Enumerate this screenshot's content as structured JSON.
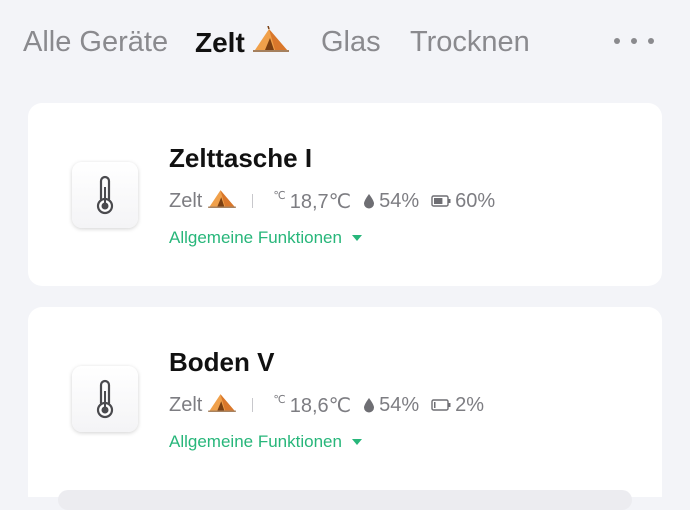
{
  "tabs": [
    {
      "label": "Alle Geräte",
      "active": false
    },
    {
      "label": "Zelt",
      "active": true,
      "icon": "tent-icon"
    },
    {
      "label": "Glas",
      "active": false
    },
    {
      "label": "Trocknen",
      "active": false
    }
  ],
  "more_icon": "more-horizontal-icon",
  "accent_color": "#27b67a",
  "devices": [
    {
      "name": "Zelttasche I",
      "room": "Zelt",
      "room_icon": "tent-icon",
      "device_icon": "thermometer-icon",
      "temp_unit_icon": "℃",
      "temperature": "18,7℃",
      "humidity": "54%",
      "battery": "60%",
      "functions_label": "Allgemeine Funktionen"
    },
    {
      "name": "Boden V",
      "room": "Zelt",
      "room_icon": "tent-icon",
      "device_icon": "thermometer-icon",
      "temp_unit_icon": "℃",
      "temperature": "18,6℃",
      "humidity": "54%",
      "battery": "2%",
      "functions_label": "Allgemeine Funktionen"
    }
  ]
}
